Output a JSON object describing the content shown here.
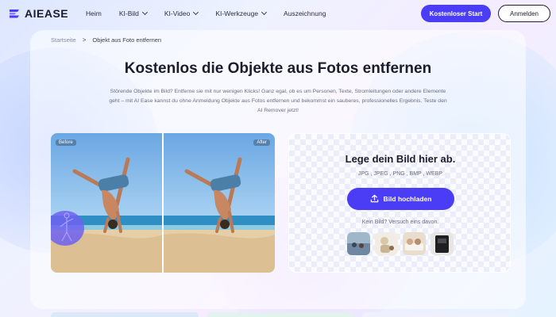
{
  "header": {
    "logo": "AIEASE",
    "nav": [
      {
        "label": "Heim",
        "dropdown": false
      },
      {
        "label": "KI-Bild",
        "dropdown": true
      },
      {
        "label": "KI-Video",
        "dropdown": true
      },
      {
        "label": "KI-Werkzeuge",
        "dropdown": true
      },
      {
        "label": "Auszeichnung",
        "dropdown": false
      }
    ],
    "start_label": "Kostenloser Start",
    "login_label": "Anmelden"
  },
  "breadcrumb": {
    "home": "Startseite",
    "separator": ">",
    "current": "Objekt aus Foto entfernen"
  },
  "hero": {
    "title": "Kostenlos die Objekte aus Fotos entfernen",
    "description": "Störende Objekte im Bild? Entferne sie mit nur wenigen Klicks! Ganz egal, ob es um Personen, Texte, Stromleitungen oder andere Elemente geht – mit AI Ease kannst du ohne Anmeldung Objekte aus Fotos entfernen und bekommst ein sauberes, professionelles Ergebnis. Teste den AI Remover jetzt!"
  },
  "compare": {
    "before_label": "Before",
    "after_label": "After"
  },
  "upload": {
    "title": "Lege dein Bild hier ab.",
    "formats": "JPG , JPEG , PNG , BMP , WEBP",
    "button_label": "Bild hochladen",
    "samples_label": "Kein Bild? Versuch eins davon."
  },
  "colors": {
    "accent": "#4b3df5",
    "sky": "#7fb2e6",
    "sea": "#3f9ec9",
    "sand": "#e7cfa5"
  },
  "icons": [
    "logo-icon",
    "chevron-down-icon",
    "upload-icon"
  ]
}
